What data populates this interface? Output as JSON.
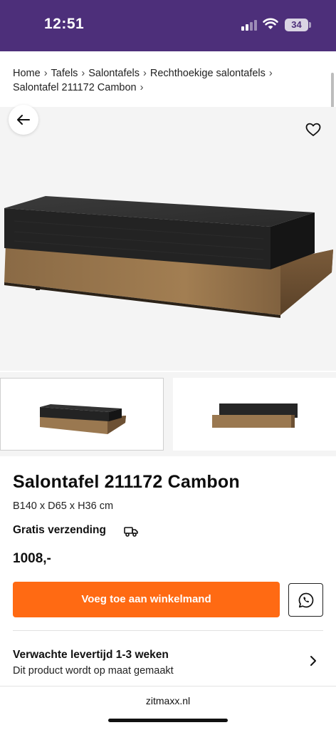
{
  "status_bar": {
    "time": "12:51",
    "battery": "34",
    "icons": [
      "cellular-signal-icon",
      "wifi-icon",
      "battery-icon"
    ]
  },
  "breadcrumb": {
    "items": [
      "Home",
      "Tafels",
      "Salontafels",
      "Rechthoekige salontafels",
      "Salontafel 211172 Cambon"
    ],
    "separator": "›"
  },
  "gallery": {
    "back_icon": "arrow-left-icon",
    "favorite_icon": "heart-icon",
    "main_image": "coffee-table-product-photo",
    "thumbnails": [
      "coffee-table-angle-view",
      "coffee-table-front-view"
    ]
  },
  "product": {
    "title": "Salontafel 211172 Cambon",
    "dimensions": "B140 x D65 x H36 cm",
    "shipping": "Gratis verzending",
    "shipping_icon": "truck-icon",
    "price": "1008,-"
  },
  "actions": {
    "add_to_cart": "Voeg toe aan winkelmand",
    "whatsapp_icon": "whatsapp-icon"
  },
  "delivery": {
    "title": "Verwachte levertijd 1-3 weken",
    "subtitle": "Dit product wordt op maat gemaakt",
    "chevron_icon": "chevron-right-icon"
  },
  "browser": {
    "url": "zitmaxx.nl"
  },
  "colors": {
    "status_bar": "#4d2f7a",
    "accent": "#ff6a13"
  }
}
